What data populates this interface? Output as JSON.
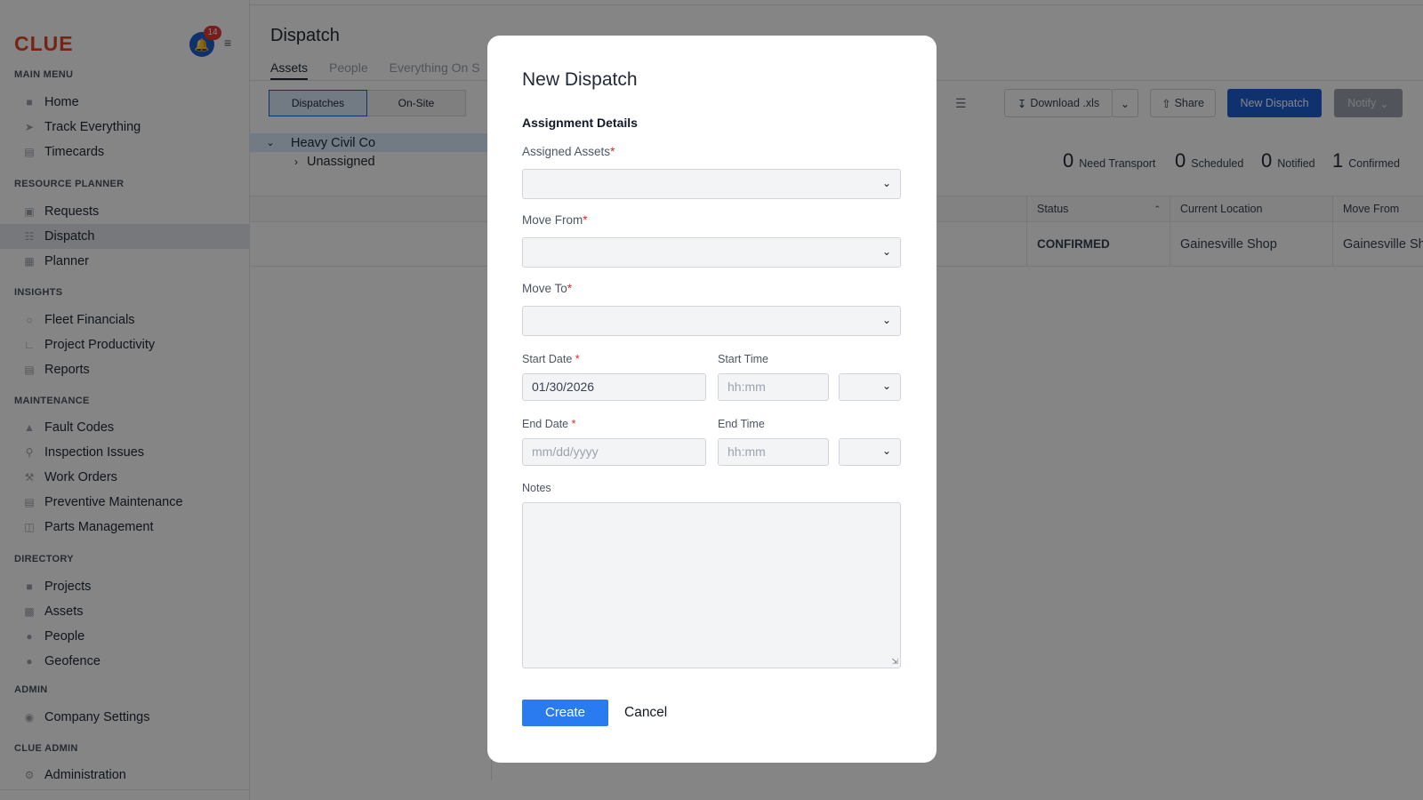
{
  "app": {
    "logo": "CLUE",
    "notification_count": "14"
  },
  "sidebar": {
    "sections": [
      {
        "title": "MAIN MENU",
        "items": [
          {
            "label": "Home",
            "icon": "home-icon"
          },
          {
            "label": "Track Everything",
            "icon": "navigation-icon"
          },
          {
            "label": "Timecards",
            "icon": "timecard-icon"
          }
        ]
      },
      {
        "title": "RESOURCE PLANNER",
        "items": [
          {
            "label": "Requests",
            "icon": "requests-icon"
          },
          {
            "label": "Dispatch",
            "icon": "dispatch-icon",
            "active": true
          },
          {
            "label": "Planner",
            "icon": "planner-icon"
          }
        ]
      },
      {
        "title": "INSIGHTS",
        "items": [
          {
            "label": "Fleet Financials",
            "icon": "financials-icon"
          },
          {
            "label": "Project Productivity",
            "icon": "productivity-icon"
          },
          {
            "label": "Reports",
            "icon": "reports-icon"
          }
        ]
      },
      {
        "title": "MAINTENANCE",
        "items": [
          {
            "label": "Fault Codes",
            "icon": "warning-icon"
          },
          {
            "label": "Inspection Issues",
            "icon": "inspection-icon"
          },
          {
            "label": "Work Orders",
            "icon": "wrench-icon"
          },
          {
            "label": "Preventive Maintenance",
            "icon": "maintenance-icon"
          },
          {
            "label": "Parts Management",
            "icon": "box-icon"
          }
        ]
      },
      {
        "title": "DIRECTORY",
        "items": [
          {
            "label": "Projects",
            "icon": "folder-icon"
          },
          {
            "label": "Assets",
            "icon": "truck-icon"
          },
          {
            "label": "People",
            "icon": "people-icon"
          },
          {
            "label": "Geofence",
            "icon": "location-pin-icon"
          }
        ]
      },
      {
        "title": "ADMIN",
        "items": [
          {
            "label": "Company Settings",
            "icon": "company-icon"
          }
        ]
      },
      {
        "title": "CLUE ADMIN",
        "items": [
          {
            "label": "Administration",
            "icon": "gear-icon"
          }
        ]
      }
    ]
  },
  "main": {
    "title": "Dispatch",
    "tabs": [
      "Assets",
      "People",
      "Everything On S"
    ],
    "segments": [
      "Dispatches",
      "On-Site"
    ],
    "tree": {
      "root": "Heavy Civil Co",
      "child": "Unassigned"
    },
    "toolbar": {
      "download": "Download .xls",
      "share": "Share",
      "new_dispatch": "New Dispatch",
      "notify": "Notify"
    },
    "counts": [
      {
        "num": "0",
        "label": "Need Transport"
      },
      {
        "num": "0",
        "label": "Scheduled"
      },
      {
        "num": "0",
        "label": "Notified"
      },
      {
        "num": "1",
        "label": "Confirmed"
      }
    ],
    "table": {
      "columns": [
        "Status",
        "Current Location",
        "Move From"
      ],
      "row": [
        "CONFIRMED",
        "Gainesville Shop",
        "Gainesville Sh"
      ]
    }
  },
  "modal": {
    "title": "New Dispatch",
    "subtitle": "Assignment Details",
    "assigned_assets_label": "Assigned Assets",
    "move_from_label": "Move From",
    "move_to_label": "Move To",
    "required_mark": "*",
    "start_date_label": "Start Date",
    "start_date_value": "01/30/2026",
    "start_time_label": "Start Time",
    "time_placeholder": "hh:mm",
    "end_date_label": "End Date",
    "date_placeholder": "mm/dd/yyyy",
    "end_time_label": "End Time",
    "notes_label": "Notes",
    "create_label": "Create",
    "cancel_label": "Cancel"
  },
  "colors": {
    "brand": "#e0482a",
    "primary": "#1d5fd1",
    "create_button": "#2a7bf0",
    "required": "#dc2626"
  }
}
